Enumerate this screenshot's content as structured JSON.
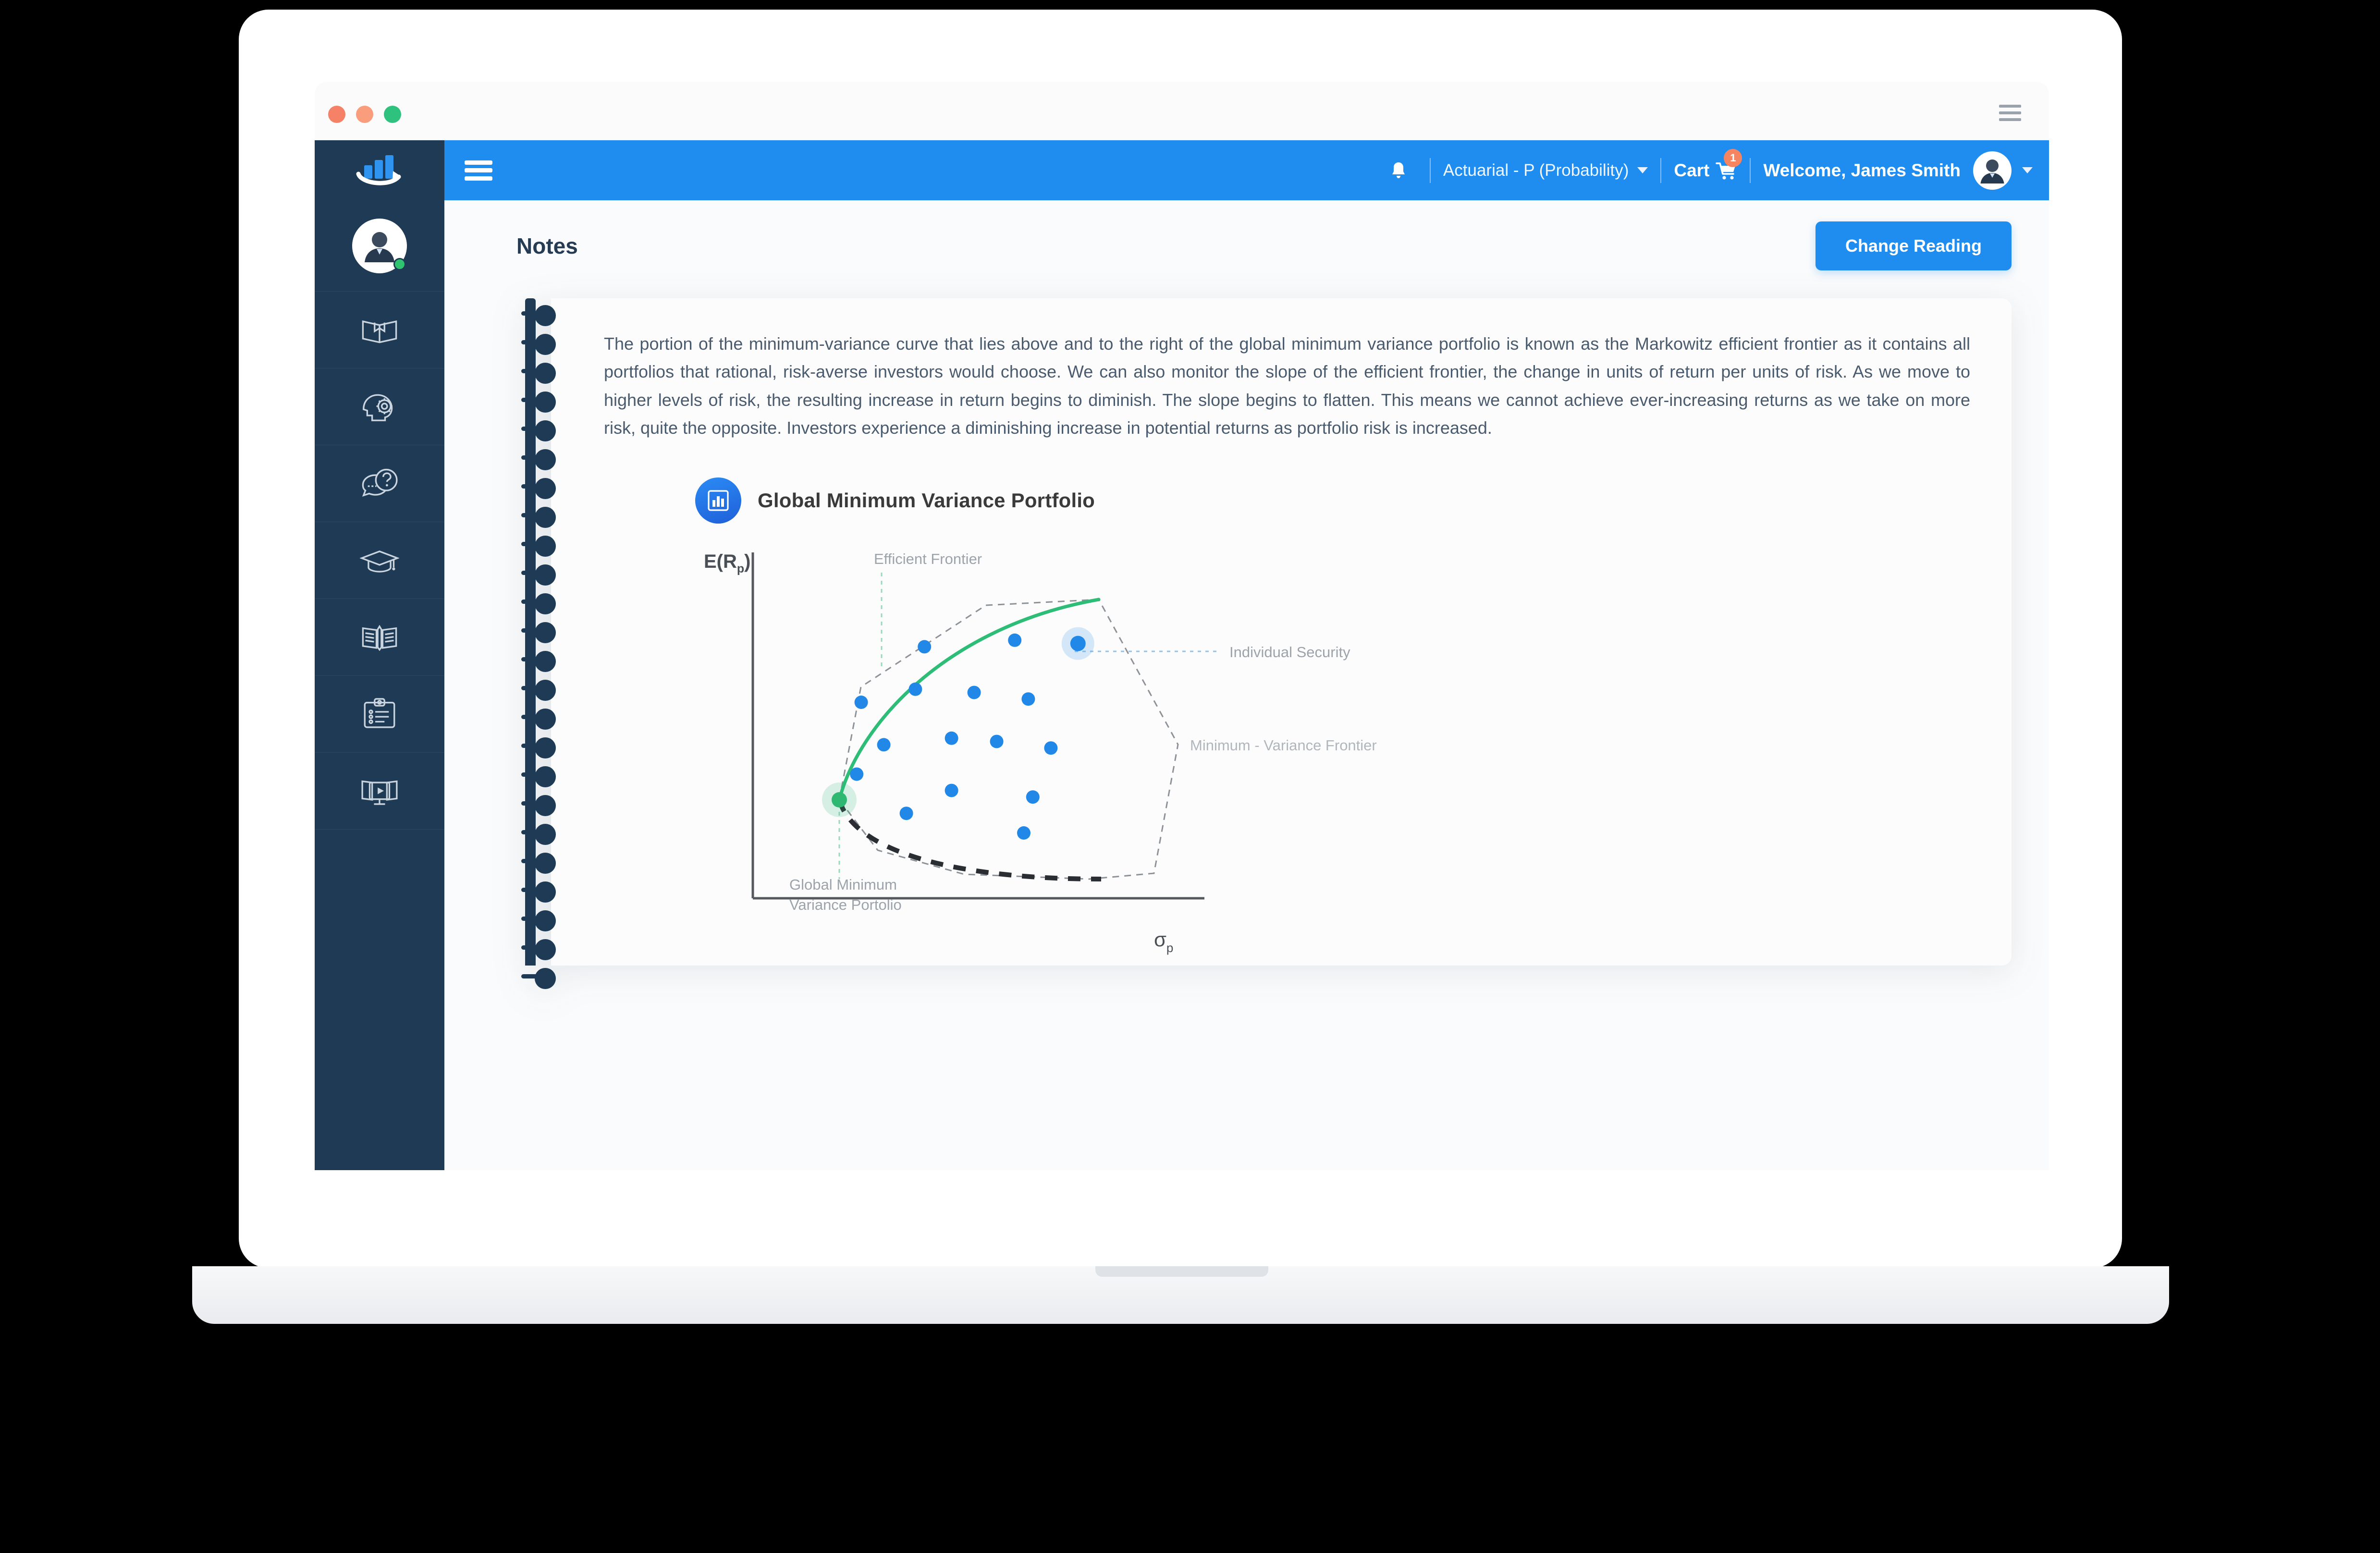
{
  "browser": {
    "traffic_lights": [
      "close",
      "minimize",
      "maximize"
    ],
    "menu_icon": "hamburger-icon"
  },
  "sidebar": {
    "logo_icon": "bar-chart-growth-logo",
    "avatar_icon": "user-avatar",
    "status": "online",
    "items": [
      {
        "icon": "open-book-bookmark-icon",
        "name": "study-manual"
      },
      {
        "icon": "head-gear-icon",
        "name": "learn"
      },
      {
        "icon": "question-chat-icon",
        "name": "questions"
      },
      {
        "icon": "graduation-cap-icon",
        "name": "exams"
      },
      {
        "icon": "open-book-pencil-icon",
        "name": "notes"
      },
      {
        "icon": "clipboard-checklist-icon",
        "name": "assignments"
      },
      {
        "icon": "book-video-play-icon",
        "name": "videos"
      }
    ]
  },
  "topbar": {
    "menu_icon": "hamburger-icon",
    "bell_icon": "notification-bell-icon",
    "course": "Actuarial - P (Probability)",
    "course_caret": "chevron-down-icon",
    "cart_label": "Cart",
    "cart_icon": "shopping-cart-icon",
    "cart_badge": "1",
    "welcome": "Welcome, James Smith",
    "avatar_icon": "user-avatar",
    "user_caret": "chevron-down-icon"
  },
  "page": {
    "title": "Notes",
    "change_reading_label": "Change Reading"
  },
  "note": {
    "body": "The portion of the minimum-variance curve that lies above and to the right of the global minimum variance portfolio is known as the Markowitz efficient frontier as it contains all portfolios that rational, risk-averse investors would choose. We can also monitor the slope of the efficient frontier, the change in units of return per units of risk. As we move to higher levels of risk, the resulting increase in return begins to diminish. The slope begins to flatten. This means we cannot achieve ever-increasing returns as we take on more risk, quite the opposite. Investors experience a diminishing increase in potential returns as portfolio risk is increased."
  },
  "figure": {
    "badge_icon": "bar-chart-icon",
    "title": "Global Minimum Variance Portfolio"
  },
  "chart_data": {
    "type": "scatter",
    "title": "Global Minimum Variance Portfolio",
    "xlabel": "σp",
    "ylabel": "E(Rp)",
    "ylabel_text": "E(R",
    "ylabel_sub": "p",
    "ylabel_close": ")",
    "xlabel_text": "σ",
    "xlabel_sub": "p",
    "xlim": [
      0,
      100
    ],
    "ylim": [
      0,
      100
    ],
    "grid": false,
    "legend": "annotations",
    "annotations": [
      {
        "label": "Efficient Frontier",
        "x": 27,
        "y": 95,
        "leader": "dashed-vertical",
        "color": "#9ad9bb"
      },
      {
        "label": "Individual Security",
        "x": 83,
        "y": 74,
        "leader": "dotted-horizontal",
        "color": "#8fc4ef"
      },
      {
        "label": "Minimum - Variance Frontier",
        "x": 86,
        "y": 44,
        "leader": "none",
        "color": "#b9bdc2"
      },
      {
        "label": "Global Minimum\nVariance Portolio",
        "x": 10,
        "y": 13,
        "leader": "dashed-vertical",
        "color": "#9ad9bb"
      }
    ],
    "annotation_labels": {
      "efficient_frontier": "Efficient Frontier",
      "individual_security": "Individual Security",
      "minimum_variance_frontier": "Minimum - Variance Frontier",
      "gmvp_line1": "Global Minimum",
      "gmvp_line2": "Variance Portolio"
    },
    "series": [
      {
        "name": "Individual Securities",
        "type": "scatter",
        "color": "#2288e8",
        "points": [
          {
            "x": 38,
            "y": 77
          },
          {
            "x": 58,
            "y": 79
          },
          {
            "x": 72,
            "y": 78,
            "highlighted": true
          },
          {
            "x": 36,
            "y": 64
          },
          {
            "x": 49,
            "y": 63
          },
          {
            "x": 61,
            "y": 61
          },
          {
            "x": 24,
            "y": 60
          },
          {
            "x": 29,
            "y": 47
          },
          {
            "x": 44,
            "y": 49
          },
          {
            "x": 54,
            "y": 48
          },
          {
            "x": 66,
            "y": 46
          },
          {
            "x": 23,
            "y": 38
          },
          {
            "x": 44,
            "y": 33
          },
          {
            "x": 62,
            "y": 31
          },
          {
            "x": 34,
            "y": 26
          },
          {
            "x": 60,
            "y": 20
          }
        ]
      },
      {
        "name": "Efficient Frontier",
        "type": "curve",
        "color": "#2ebd77",
        "style": "solid",
        "from": {
          "x": 8,
          "y": 53
        },
        "to": {
          "x": 78,
          "y": 92
        }
      },
      {
        "name": "Minimum Variance Frontier (lower)",
        "type": "curve",
        "color": "#2a2e33",
        "style": "dashed",
        "from": {
          "x": 8,
          "y": 53
        },
        "to": {
          "x": 79,
          "y": 9
        }
      },
      {
        "name": "Feasible Set Boundary",
        "type": "polygon",
        "color": "#7b8086",
        "style": "dashed"
      }
    ],
    "markers": [
      {
        "name": "Global Minimum Variance Portfolio",
        "x": 8,
        "y": 53,
        "color": "#2eb872",
        "halo": true
      },
      {
        "name": "Individual Security",
        "x": 72,
        "y": 78,
        "color": "#2288e8",
        "halo": true
      }
    ]
  }
}
